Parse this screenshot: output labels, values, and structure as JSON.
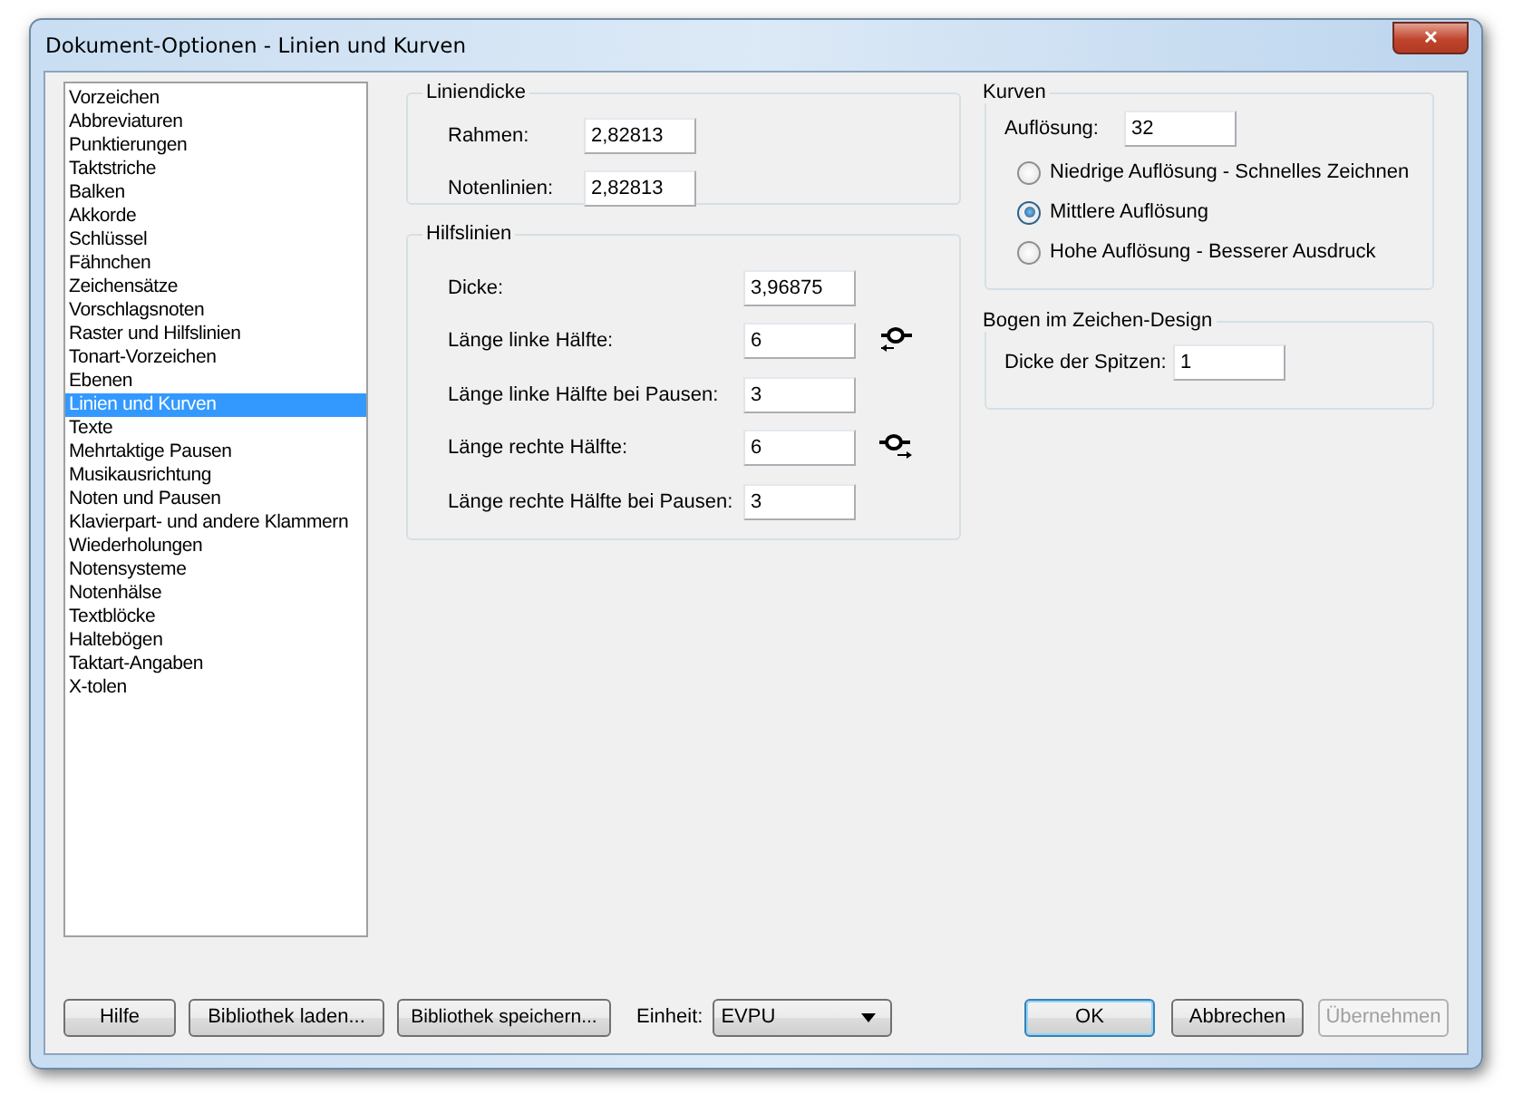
{
  "window": {
    "title": "Dokument-Optionen - Linien und Kurven",
    "close": "✕"
  },
  "categories": [
    {
      "label": "Vorzeichen",
      "selected": false
    },
    {
      "label": "Abbreviaturen",
      "selected": false
    },
    {
      "label": "Punktierungen",
      "selected": false
    },
    {
      "label": "Taktstriche",
      "selected": false
    },
    {
      "label": "Balken",
      "selected": false
    },
    {
      "label": "Akkorde",
      "selected": false
    },
    {
      "label": "Schlüssel",
      "selected": false
    },
    {
      "label": "Fähnchen",
      "selected": false
    },
    {
      "label": "Zeichensätze",
      "selected": false
    },
    {
      "label": "Vorschlagsnoten",
      "selected": false
    },
    {
      "label": "Raster und Hilfslinien",
      "selected": false
    },
    {
      "label": "Tonart-Vorzeichen",
      "selected": false
    },
    {
      "label": "Ebenen",
      "selected": false
    },
    {
      "label": "Linien und Kurven",
      "selected": true
    },
    {
      "label": "Texte",
      "selected": false
    },
    {
      "label": "Mehrtaktige Pausen",
      "selected": false
    },
    {
      "label": "Musikausrichtung",
      "selected": false
    },
    {
      "label": "Noten und Pausen",
      "selected": false
    },
    {
      "label": "Klavierpart- und andere Klammern",
      "selected": false
    },
    {
      "label": "Wiederholungen",
      "selected": false
    },
    {
      "label": "Notensysteme",
      "selected": false
    },
    {
      "label": "Notenhälse",
      "selected": false
    },
    {
      "label": "Textblöcke",
      "selected": false
    },
    {
      "label": "Haltebögen",
      "selected": false
    },
    {
      "label": "Taktart-Angaben",
      "selected": false
    },
    {
      "label": "X-tolen",
      "selected": false
    }
  ],
  "liniendicke": {
    "title": "Liniendicke",
    "fields": [
      {
        "label": "Rahmen:",
        "value": "2,82813"
      },
      {
        "label": "Notenlinien:",
        "value": "2,82813"
      }
    ]
  },
  "hilfslinien": {
    "title": "Hilfslinien",
    "fields": [
      {
        "label": "Dicke:",
        "value": "3,96875"
      },
      {
        "label": "Länge linke Hälfte:",
        "value": "6"
      },
      {
        "label": "Länge linke Hälfte bei Pausen:",
        "value": "3"
      },
      {
        "label": "Länge rechte Hälfte:",
        "value": "6"
      },
      {
        "label": "Länge rechte Hälfte bei Pausen:",
        "value": "3"
      }
    ]
  },
  "kurven": {
    "title": "Kurven",
    "field": {
      "label": "Auflösung:",
      "value": "32"
    },
    "options": [
      {
        "label": "Niedrige Auflösung - Schnelles Zeichnen",
        "selected": false
      },
      {
        "label": "Mittlere Auflösung",
        "selected": true
      },
      {
        "label": "Hohe Auflösung - Besserer Ausdruck",
        "selected": false
      }
    ]
  },
  "bogen": {
    "title": "Bogen im Zeichen-Design",
    "field": {
      "label": "Dicke der Spitzen:",
      "value": "1"
    }
  },
  "left_buttons": [
    {
      "label": "Hilfe"
    },
    {
      "label": "Bibliothek laden..."
    },
    {
      "label": "Bibliothek speichern..."
    }
  ],
  "unit": {
    "label": "Einheit:",
    "value": "EVPU"
  },
  "right_buttons": [
    {
      "label": "OK",
      "default": true,
      "disabled": false
    },
    {
      "label": "Abbrechen",
      "default": false,
      "disabled": false
    },
    {
      "label": "Übernehmen",
      "default": false,
      "disabled": true
    }
  ]
}
